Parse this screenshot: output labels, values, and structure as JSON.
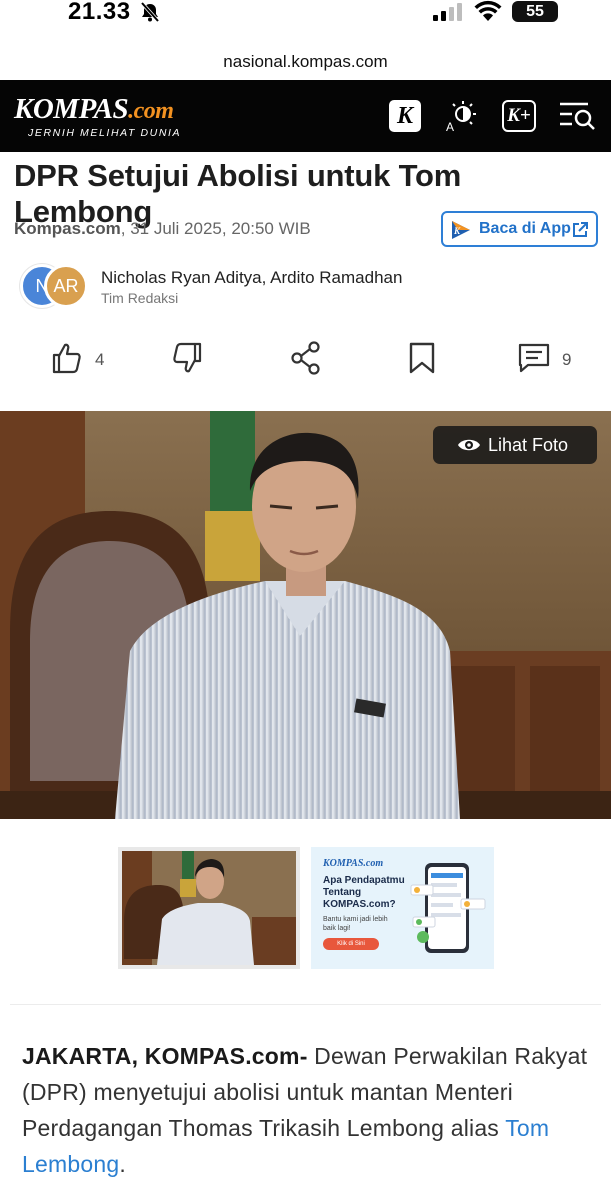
{
  "status_bar": {
    "time": "21.33",
    "battery": "55",
    "icons": [
      "bell-muted-icon",
      "signal-icon",
      "wifi-icon",
      "battery-icon"
    ]
  },
  "browser": {
    "url": "nasional.kompas.com"
  },
  "header": {
    "logo_text": "KOMPAS",
    "logo_suffix": ".com",
    "tagline": "JERNIH MELIHAT DUNIA",
    "k_button": "K",
    "kplus_button": "K+",
    "icons": [
      "contrast-icon",
      "menu-search-icon"
    ]
  },
  "article": {
    "title": "DPR Setujui Abolisi untuk Tom Lembong",
    "source": "Kompas.com",
    "datetime": ", 31 Juli 2025, 20:50 WIB",
    "app_button": "Baca di App",
    "authors": {
      "avatar1": "N",
      "avatar2": "AR",
      "names": "Nicholas Ryan Aditya,  Ardito Ramadhan",
      "role": "Tim Redaksi"
    },
    "actions": {
      "like_count": "4",
      "comment_count": "9"
    },
    "photo_button": "Lihat Foto",
    "ad": {
      "brand": "KOMPAS.com",
      "headline": "Apa Pendapatmu Tentang KOMPAS.com?",
      "sub": "Bantu kami jadi lebih baik lagi!",
      "cta": "Klik di Sini"
    },
    "body": {
      "dateline": "JAKARTA, KOMPAS.com-",
      "text": " Dewan Perwakilan Rakyat (DPR) menyetujui abolisi untuk mantan Menteri Perdagangan Thomas Trikasih Lembong alias ",
      "link": "Tom Lembong",
      "end": "."
    }
  },
  "colors": {
    "header_bg": "#050505",
    "accent_orange": "#f39221",
    "link_blue": "#2b7fd1",
    "app_button_blue": "#2e7fd6"
  }
}
